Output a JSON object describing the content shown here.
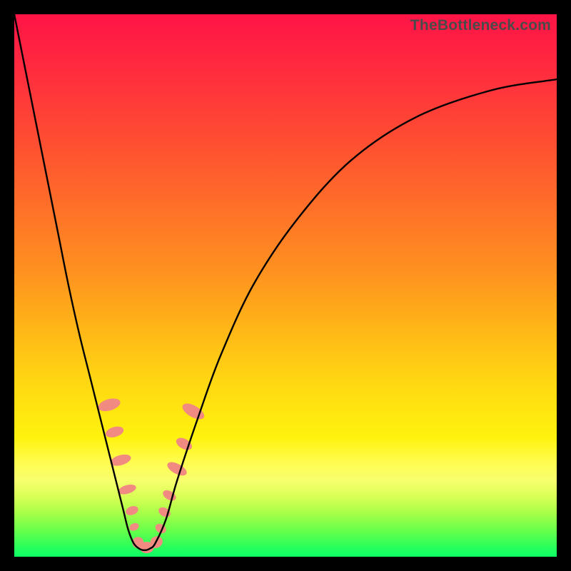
{
  "watermark": "TheBottleneck.com",
  "colors": {
    "curve": "#000000",
    "marker": "#f18b81",
    "frame": "#000000"
  },
  "chart_data": {
    "type": "line",
    "title": "",
    "xlabel": "",
    "ylabel": "",
    "xlim": [
      0,
      100
    ],
    "ylim": [
      0,
      100
    ],
    "series": [
      {
        "name": "bottleneck-curve",
        "x": [
          0,
          2,
          4,
          6,
          8,
          10,
          12,
          14,
          16,
          18,
          20,
          21,
          22,
          23,
          24,
          25,
          26,
          28,
          30,
          34,
          38,
          44,
          52,
          62,
          74,
          88,
          100
        ],
        "y": [
          100,
          90,
          80,
          70,
          60,
          50,
          41,
          33,
          25,
          17,
          9,
          5,
          2.5,
          1.5,
          1.2,
          1.5,
          2.5,
          7,
          14,
          26,
          37,
          50,
          62,
          73,
          81,
          86,
          88
        ]
      }
    ],
    "markers": [
      {
        "x_pct": 17.5,
        "y_pct_from_top": 72,
        "rx": 8,
        "ry": 16,
        "rot": 74
      },
      {
        "x_pct": 18.5,
        "y_pct_from_top": 77,
        "rx": 7,
        "ry": 13,
        "rot": 74
      },
      {
        "x_pct": 19.6,
        "y_pct_from_top": 82.2,
        "rx": 7,
        "ry": 15,
        "rot": 74
      },
      {
        "x_pct": 20.8,
        "y_pct_from_top": 87.6,
        "rx": 6,
        "ry": 13,
        "rot": 74
      },
      {
        "x_pct": 21.7,
        "y_pct_from_top": 91.5,
        "rx": 6,
        "ry": 9,
        "rot": 70
      },
      {
        "x_pct": 22.1,
        "y_pct_from_top": 94.5,
        "rx": 5,
        "ry": 7,
        "rot": 65
      },
      {
        "x_pct": 22.8,
        "y_pct_from_top": 97.4,
        "rx": 8,
        "ry": 8,
        "rot": 30
      },
      {
        "x_pct": 24.4,
        "y_pct_from_top": 98.3,
        "rx": 10,
        "ry": 8,
        "rot": 0
      },
      {
        "x_pct": 26.2,
        "y_pct_from_top": 97.3,
        "rx": 9,
        "ry": 8,
        "rot": -35
      },
      {
        "x_pct": 27.0,
        "y_pct_from_top": 94.8,
        "rx": 6,
        "ry": 8,
        "rot": -58
      },
      {
        "x_pct": 27.7,
        "y_pct_from_top": 91.8,
        "rx": 6,
        "ry": 9,
        "rot": -60
      },
      {
        "x_pct": 28.6,
        "y_pct_from_top": 88.7,
        "rx": 6,
        "ry": 10,
        "rot": -60
      },
      {
        "x_pct": 30.0,
        "y_pct_from_top": 83.8,
        "rx": 7,
        "ry": 15,
        "rot": -62
      },
      {
        "x_pct": 31.3,
        "y_pct_from_top": 79.2,
        "rx": 7,
        "ry": 12,
        "rot": -61
      },
      {
        "x_pct": 33.0,
        "y_pct_from_top": 73.2,
        "rx": 8,
        "ry": 17,
        "rot": -60
      }
    ],
    "notes": "V-shaped bottleneck curve; minimum around x≈23–24%. Markers appear only along the curve segments near the trough where y_pct_from_top ≥ ~72%."
  }
}
